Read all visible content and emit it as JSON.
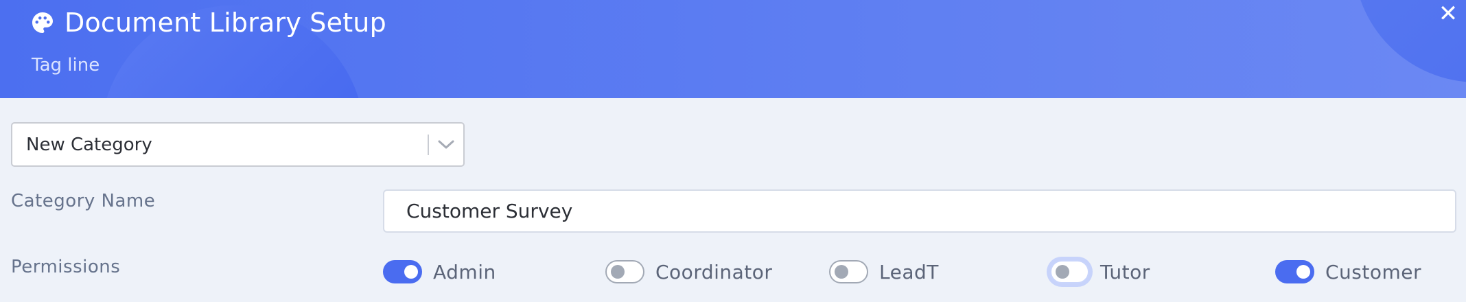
{
  "header": {
    "title": "Document Library Setup",
    "tagline": "Tag line",
    "close_label": "✕",
    "icon": "palette-icon",
    "colors": {
      "start": "#4c6ff0",
      "end": "#6b88f3"
    }
  },
  "category_select": {
    "value": "New Category",
    "icon": "chevron-down-icon"
  },
  "category_name": {
    "label": "Category Name",
    "value": "Customer Survey"
  },
  "permissions": {
    "label": "Permissions",
    "items": [
      {
        "label": "Admin",
        "checked": true
      },
      {
        "label": "Coordinator",
        "checked": false
      },
      {
        "label": "LeadT",
        "checked": false
      },
      {
        "label": "Tutor",
        "checked": false,
        "focused": true
      },
      {
        "label": "Customer",
        "checked": true
      }
    ]
  },
  "colors": {
    "accent": "#4a6cf0",
    "background": "#eef2f9",
    "label": "#66738c"
  }
}
